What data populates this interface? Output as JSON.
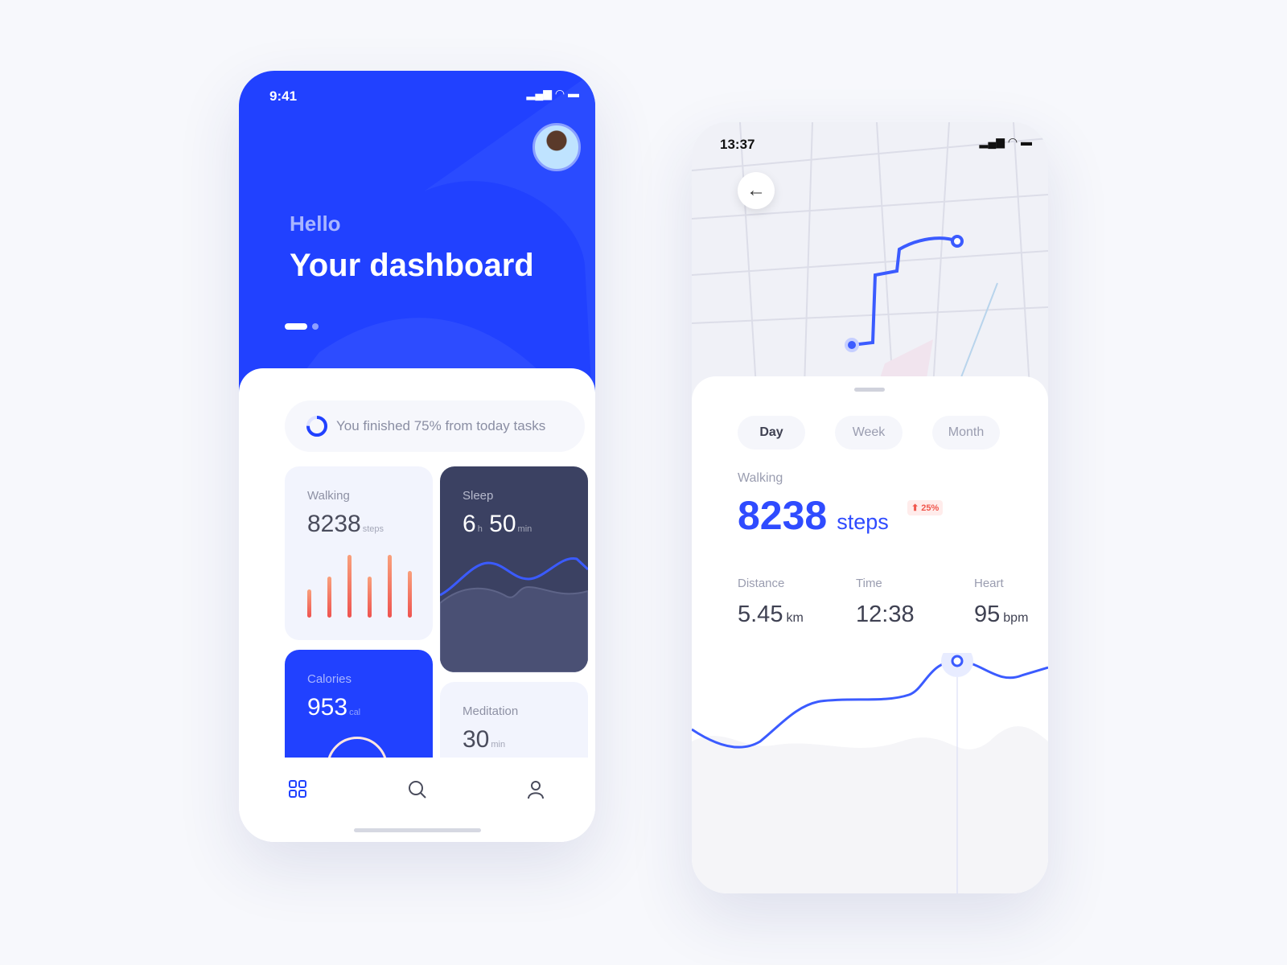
{
  "dashboard": {
    "status_time": "9:41",
    "greeting": "Hello",
    "title": "Your dashboard",
    "task_text": "You finished 75% from today tasks",
    "task_progress_percent": 75,
    "cards": {
      "walking": {
        "label": "Walking",
        "value": "8238",
        "unit": "steps",
        "bars": [
          0.45,
          0.65,
          1.0,
          0.65,
          1.0,
          0.75
        ]
      },
      "sleep": {
        "label": "Sleep",
        "hours": "6",
        "h_unit": "h",
        "minutes": "50",
        "m_unit": "min"
      },
      "calories": {
        "label": "Calories",
        "value": "953",
        "unit": "cal"
      },
      "meditation": {
        "label": "Meditation",
        "value": "30",
        "unit": "min"
      }
    },
    "nav": [
      "grid-icon",
      "search-icon",
      "user-icon"
    ],
    "accent": "#2141ff"
  },
  "detail": {
    "status_time": "13:37",
    "tabs": [
      "Day",
      "Week",
      "Month"
    ],
    "active_tab": "Day",
    "activity": "Walking",
    "steps": "8238",
    "steps_unit": "steps",
    "change": "25%",
    "stats": [
      {
        "label": "Distance",
        "value": "5.45",
        "unit": "km"
      },
      {
        "label": "Time",
        "value": "12:38",
        "unit": ""
      },
      {
        "label": "Heart",
        "value": "95",
        "unit": "bpm"
      }
    ]
  }
}
